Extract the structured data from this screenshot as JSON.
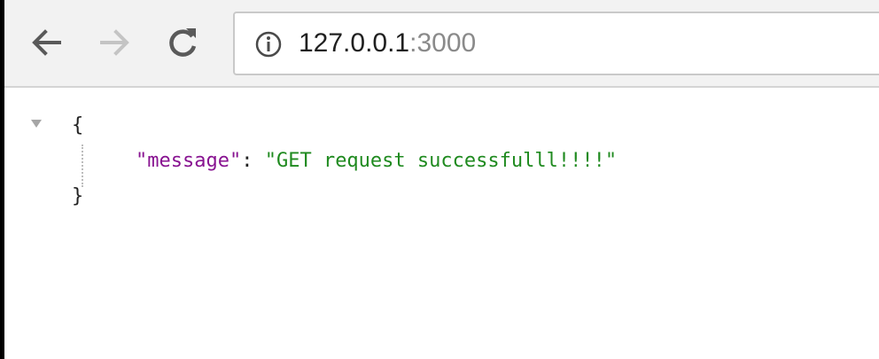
{
  "browser": {
    "address_bar": {
      "host": "127.0.0.1",
      "port": ":3000"
    }
  },
  "icons": {
    "back": "back-arrow-icon",
    "forward": "forward-arrow-icon",
    "reload": "reload-icon",
    "info": "info-icon",
    "toggle": "collapse-triangle-icon"
  },
  "json_view": {
    "open_brace": "{",
    "key": "\"message\"",
    "colon": ": ",
    "value": "\"GET request successfulll!!!!\"",
    "close_brace": "}"
  },
  "colors": {
    "key": "#881391",
    "string_value": "#1f8a1f"
  }
}
